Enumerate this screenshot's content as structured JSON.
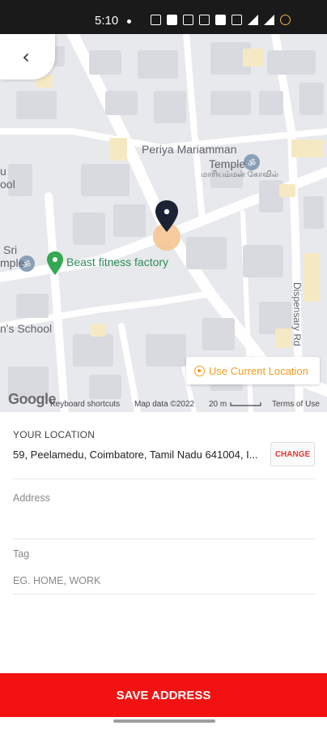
{
  "status_bar": {
    "time": "5:10"
  },
  "map": {
    "labels": {
      "temple": "Periya Mariamman",
      "temple2": "Temple",
      "temple_tamil": "மாரியம்மன் கோவில்",
      "school_left": "ool",
      "left_top": "u",
      "sri": "Sri",
      "temple_left": "mple",
      "gym": "Beast fitness factory",
      "school": "n's School",
      "dispensary": "Dispensary Rd"
    },
    "use_current_location": "Use Current Location",
    "google": "Google",
    "keyboard_shortcuts": "Keyboard shortcuts",
    "map_data": "Map data ©2022",
    "scale": "20 m",
    "terms": "Terms of Use"
  },
  "form": {
    "your_location_label": "YOUR LOCATION",
    "location_value": "59, Peelamedu, Coimbatore, Tamil Nadu 641004, I...",
    "change_label": "CHANGE",
    "address_label": "Address",
    "tag_label": "Tag",
    "tag_placeholder": "EG. HOME, WORK"
  },
  "save_button": "SAVE ADDRESS",
  "colors": {
    "accent": "#f39c1f",
    "save": "#f21212",
    "pin": "#1a2233",
    "gym_pin": "#34a853"
  }
}
